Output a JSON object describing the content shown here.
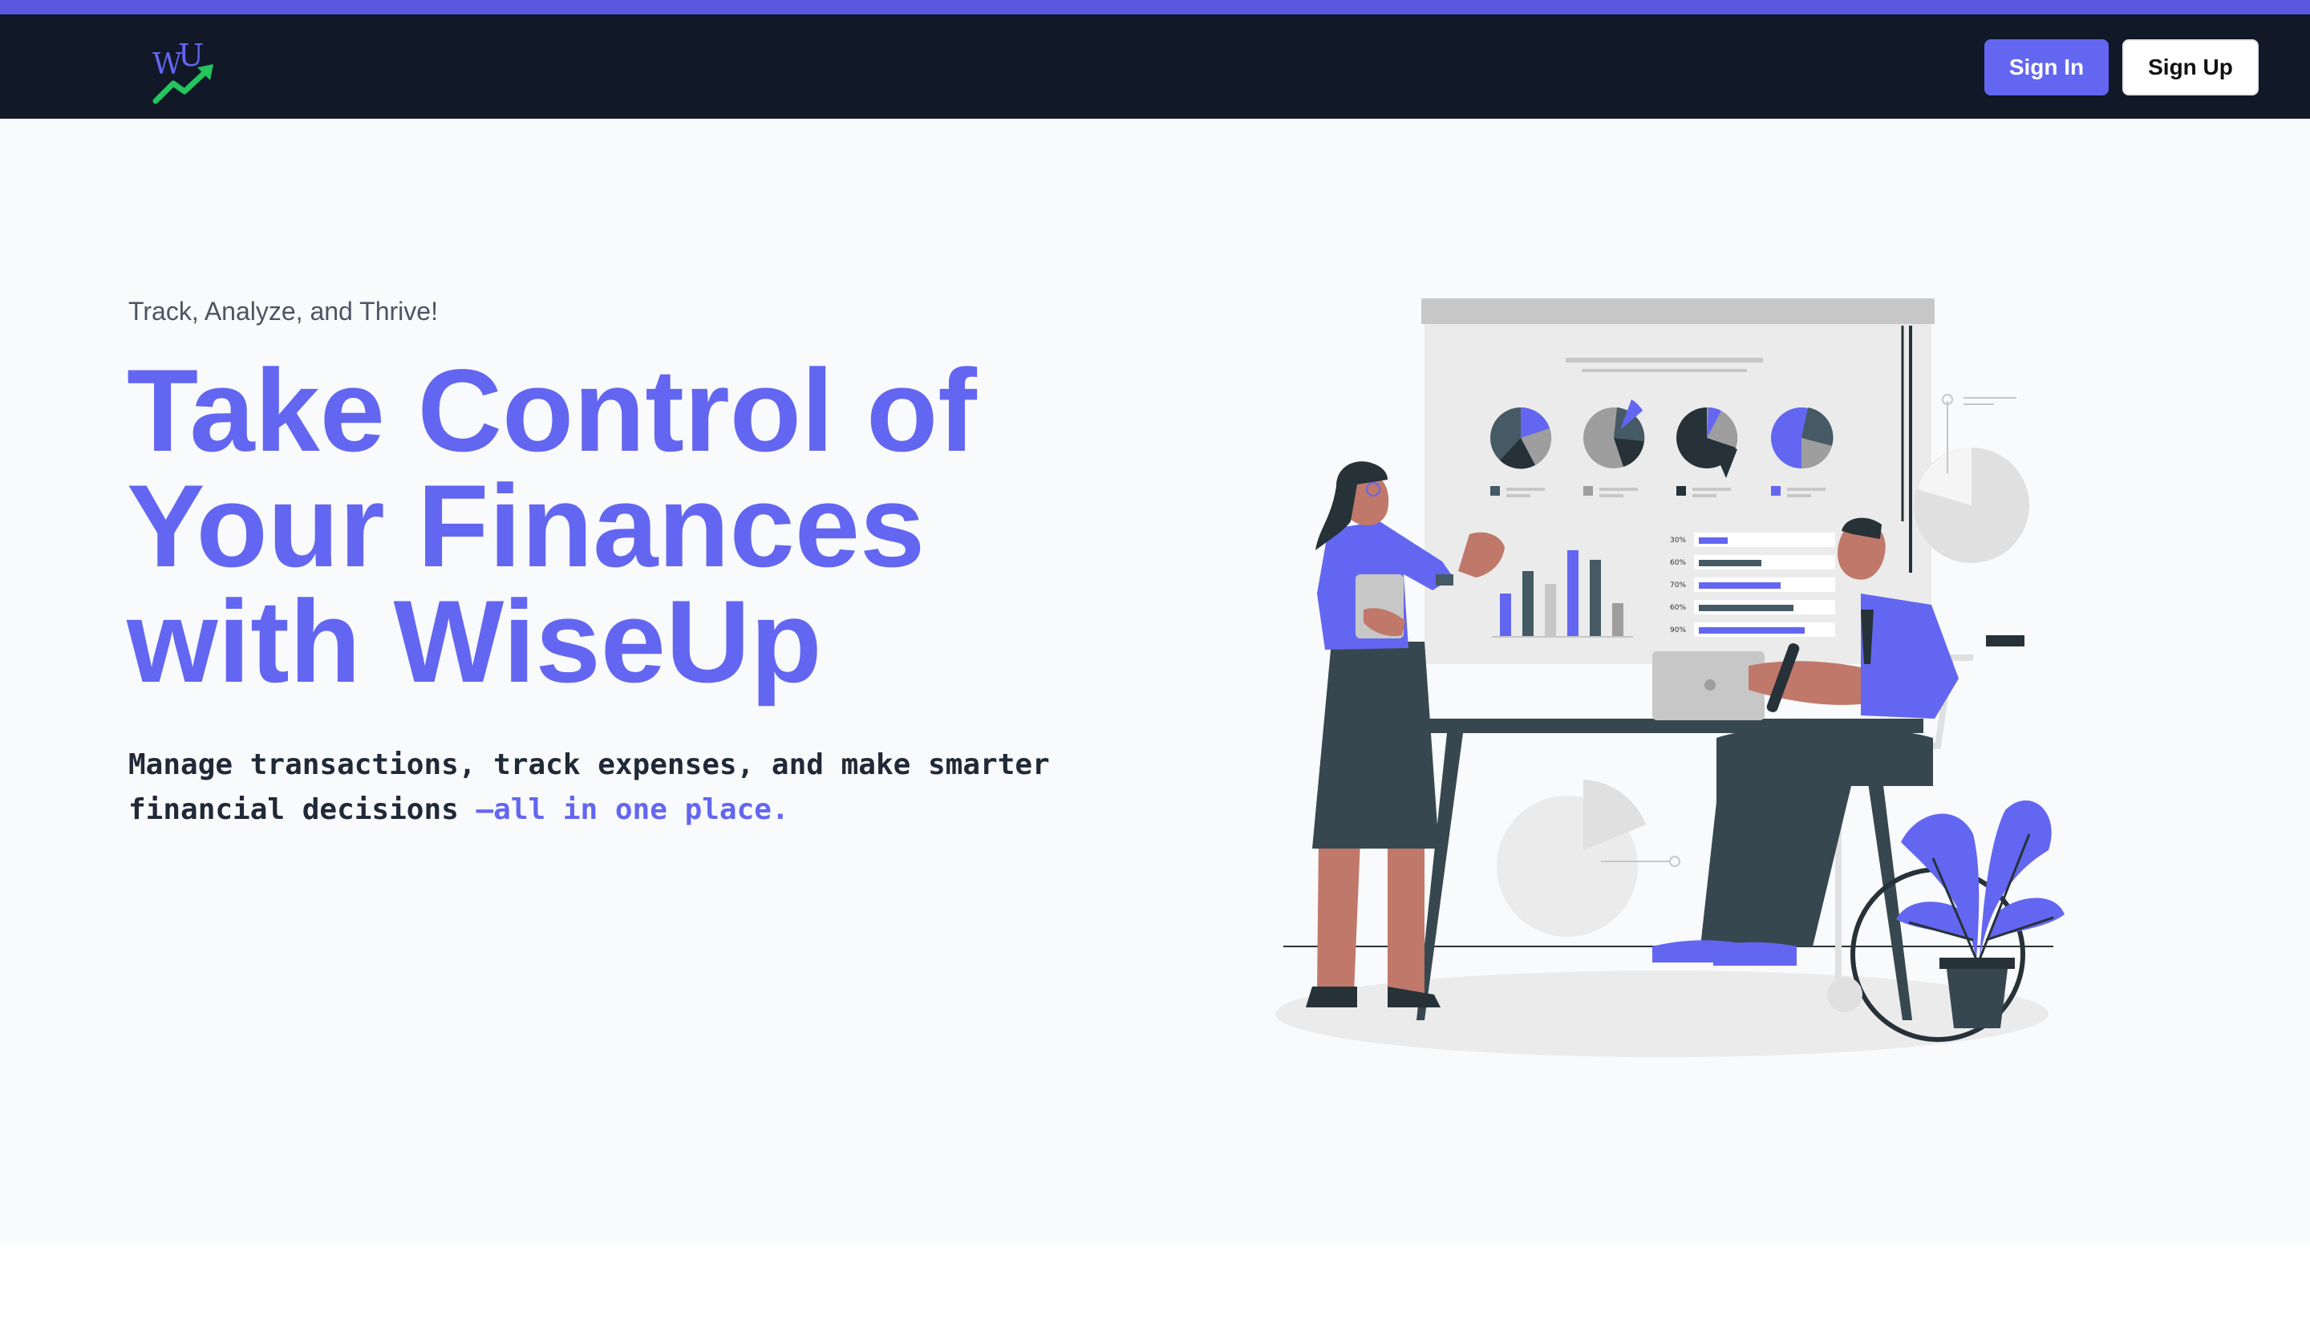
{
  "header": {
    "logo_text": "WU",
    "sign_in_label": "Sign In",
    "sign_up_label": "Sign Up"
  },
  "hero": {
    "tagline": "Track, Analyze, and Thrive!",
    "headline_lines": [
      "Take Control of",
      "Your Finances",
      "with WiseUp"
    ],
    "description_main": "Manage transactions, track expenses, and make smarter financial decisions ",
    "description_highlight": "—all in one place."
  },
  "illustration": {
    "bar_percent_labels": [
      "30%",
      "60%",
      "70%",
      "60%",
      "90%"
    ]
  },
  "colors": {
    "accent": "#6366f1",
    "topbar": "#111827",
    "accent_stripe": "#5b55e0",
    "logo_arrow": "#22c55e",
    "background": "#f9fafb"
  },
  "icons": [
    "logo-icon",
    "trending-up-arrow-icon"
  ]
}
